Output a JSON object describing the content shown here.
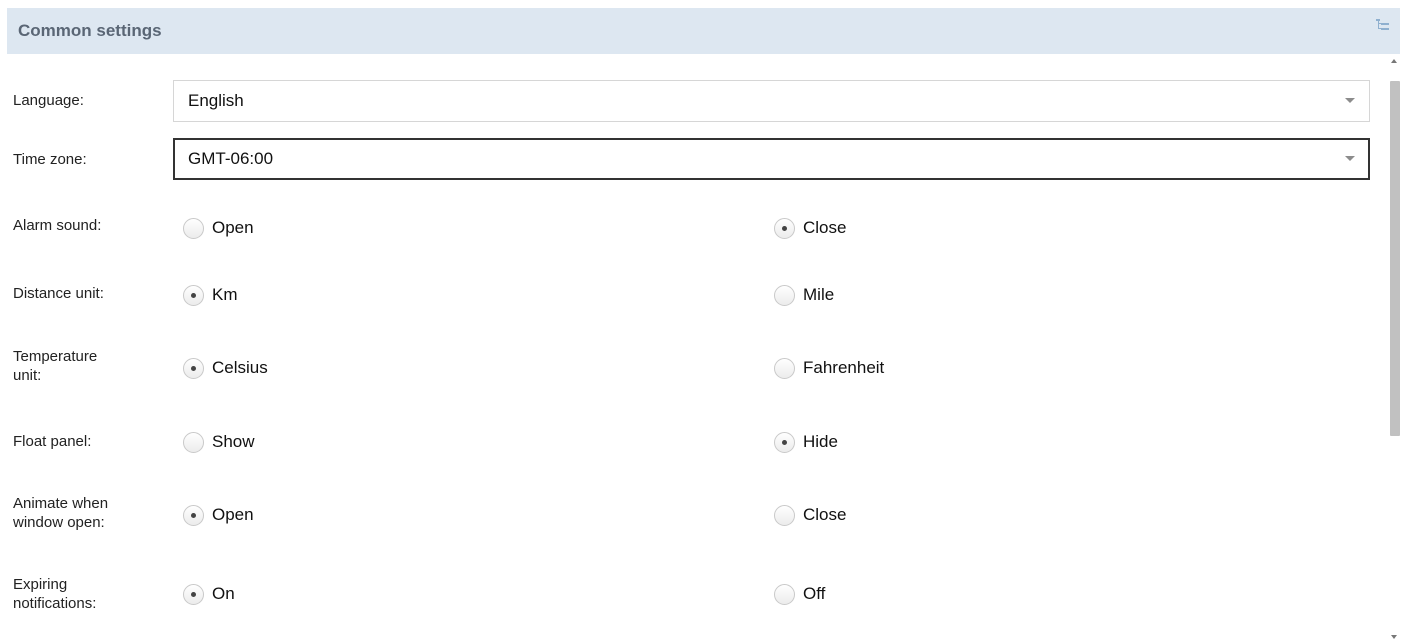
{
  "panel": {
    "title": "Common settings",
    "header_icon": "tree-list-icon"
  },
  "form": {
    "language": {
      "label": "Language:",
      "value": "English"
    },
    "timezone": {
      "label": "Time zone:",
      "value": "GMT-06:00"
    },
    "alarm_sound": {
      "label": "Alarm sound:",
      "options": [
        {
          "label": "Open",
          "checked": false
        },
        {
          "label": "Close",
          "checked": true
        }
      ]
    },
    "distance_unit": {
      "label": "Distance unit:",
      "options": [
        {
          "label": "Km",
          "checked": true
        },
        {
          "label": "Mile",
          "checked": false
        }
      ]
    },
    "temperature_unit": {
      "label_line1": "Temperature",
      "label_line2": "unit:",
      "options": [
        {
          "label": "Celsius",
          "checked": true
        },
        {
          "label": "Fahrenheit",
          "checked": false
        }
      ]
    },
    "float_panel": {
      "label": "Float panel:",
      "options": [
        {
          "label": "Show",
          "checked": false
        },
        {
          "label": "Hide",
          "checked": true
        }
      ]
    },
    "animate_window": {
      "label_line1": "Animate when",
      "label_line2": "window open:",
      "options": [
        {
          "label": "Open",
          "checked": true
        },
        {
          "label": "Close",
          "checked": false
        }
      ]
    },
    "expiring_notifications": {
      "label_line1": "Expiring",
      "label_line2": "notifications:",
      "options": [
        {
          "label": "On",
          "checked": true
        },
        {
          "label": "Off",
          "checked": false
        }
      ]
    }
  },
  "colors": {
    "header_bg": "#dde7f1",
    "header_text": "#5a6675",
    "scroll_thumb": "#c1c1c1"
  }
}
